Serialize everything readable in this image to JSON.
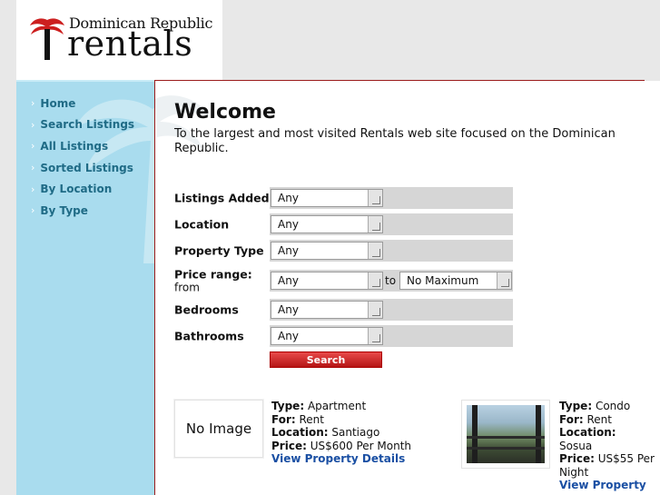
{
  "logo": {
    "line1": "Dominican Republic",
    "line2": "rentals",
    "accent_color": "#cc1f1f"
  },
  "sidebar": {
    "items": [
      {
        "label": "Home"
      },
      {
        "label": "Search Listings"
      },
      {
        "label": "All Listings"
      },
      {
        "label": "Sorted Listings"
      },
      {
        "label": "By Location"
      },
      {
        "label": "By Type"
      }
    ],
    "chevron": "›",
    "bg_color": "#a9dcee",
    "text_color": "#1f6b86"
  },
  "welcome": {
    "title": "Welcome",
    "text": "To the largest and most visited Rentals web site focused on the Dominican Republic."
  },
  "search_form": {
    "listings_added": {
      "label": "Listings Added",
      "value": "Any"
    },
    "location": {
      "label": "Location",
      "value": "Any"
    },
    "property_type": {
      "label": "Property Type",
      "value": "Any"
    },
    "price_range": {
      "label": "Price range:",
      "sublabel": "from",
      "from_value": "Any",
      "to_label": "to",
      "to_value": "No Maximum"
    },
    "bedrooms": {
      "label": "Bedrooms",
      "value": "Any"
    },
    "bathrooms": {
      "label": "Bathrooms",
      "value": "Any"
    },
    "search_button": "Search"
  },
  "listings": [
    {
      "image_text": "No Image",
      "type_label": "Type:",
      "type": "Apartment",
      "for_label": "For:",
      "for": "Rent",
      "location_label": "Location:",
      "location": "Santiago",
      "price_label": "Price:",
      "price": "US$600 Per Month",
      "link": "View Property Details"
    },
    {
      "type_label": "Type:",
      "type": "Condo",
      "for_label": "For:",
      "for": "Rent",
      "location_label": "Location:",
      "location": "Sosua",
      "price_label": "Price:",
      "price": "US$55 Per Night",
      "link": "View Property"
    }
  ]
}
